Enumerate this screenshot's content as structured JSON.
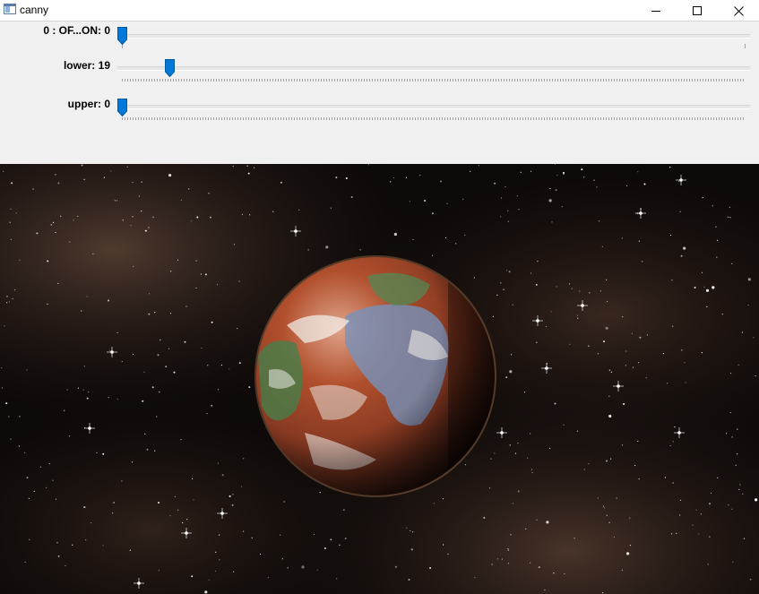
{
  "window": {
    "title": "canny",
    "app_icon": "window-app-icon",
    "controls": {
      "minimize_icon": "minimize-icon",
      "maximize_icon": "maximize-icon",
      "close_icon": "close-icon"
    }
  },
  "trackbars": [
    {
      "label": "0 : OF...ON: 0",
      "value": 0,
      "max_fraction": 0.0
    },
    {
      "label": "lower: 19",
      "value": 19,
      "max_fraction": 0.075
    },
    {
      "label": "upper: 0",
      "value": 0,
      "max_fraction": 0.0
    }
  ],
  "colors": {
    "thumb": "#0078d7",
    "panel_bg": "#f0f0f0"
  },
  "image": {
    "content": "planet-in-starfield"
  }
}
